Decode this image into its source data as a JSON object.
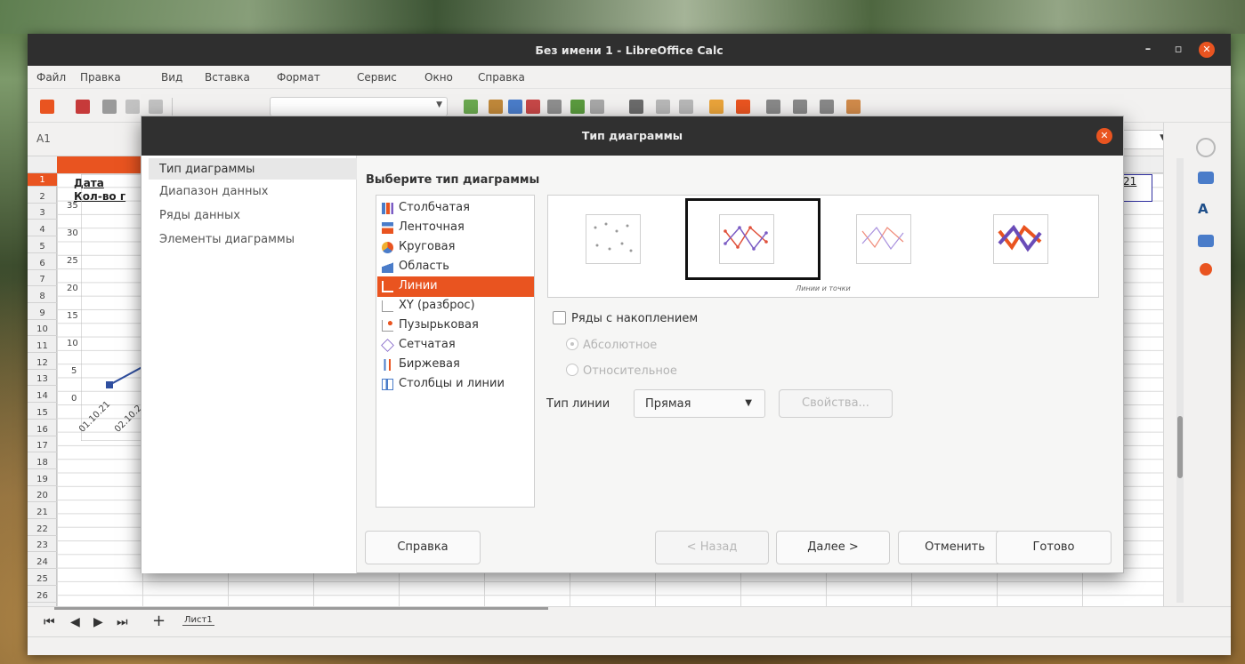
{
  "window": {
    "title": "Без имени 1 - LibreOffice Calc",
    "minimize": "–",
    "maximize": "▫",
    "close": "✕"
  },
  "menubar": [
    "Файл",
    "Правка",
    "Вид",
    "Вставка",
    "Формат",
    "Сервис",
    "Окно",
    "Справка"
  ],
  "formula": {
    "name_box": "A1"
  },
  "spreadsheet": {
    "rows": [
      "1",
      "2",
      "3",
      "4",
      "5",
      "6",
      "7",
      "8",
      "9",
      "10",
      "11",
      "12",
      "13",
      "14",
      "15",
      "16",
      "17",
      "18",
      "19",
      "20",
      "21",
      "22",
      "23",
      "24",
      "25",
      "26"
    ],
    "cell_a1": "Дата",
    "cell_a2": "Кол-во г",
    "cell_right_fragment": "21",
    "chart_y_ticks": [
      "35",
      "30",
      "25",
      "20",
      "15",
      "10",
      "5",
      "0"
    ],
    "chart_x_ticks": [
      "01.10.21",
      "02.10.2"
    ]
  },
  "sheet_tabs": {
    "nav": [
      "⏮",
      "◀",
      "▶",
      "⏭",
      "+"
    ],
    "active_tab": "Лист1"
  },
  "dialog": {
    "title": "Тип диаграммы",
    "close": "✕",
    "steps": [
      "Тип диаграммы",
      "Диапазон данных",
      "Ряды данных",
      "Элементы диаграммы"
    ],
    "heading": "Выберите тип диаграммы",
    "chart_types": [
      {
        "label": "Столбчатая",
        "icon": "column-chart-icon"
      },
      {
        "label": "Ленточная",
        "icon": "bar-chart-icon"
      },
      {
        "label": "Круговая",
        "icon": "pie-chart-icon"
      },
      {
        "label": "Область",
        "icon": "area-chart-icon"
      },
      {
        "label": "Линии",
        "icon": "line-chart-icon"
      },
      {
        "label": "XY (разброс)",
        "icon": "scatter-chart-icon"
      },
      {
        "label": "Пузырьковая",
        "icon": "bubble-chart-icon"
      },
      {
        "label": "Сетчатая",
        "icon": "net-chart-icon"
      },
      {
        "label": "Биржевая",
        "icon": "stock-chart-icon"
      },
      {
        "label": "Столбцы и линии",
        "icon": "column-line-chart-icon"
      }
    ],
    "selected_type": "Линии",
    "variant_caption": "Линии и точки",
    "stacked_label": "Ряды с накоплением",
    "absolute_label": "Абсолютное",
    "relative_label": "Относительное",
    "line_type_label": "Тип линии",
    "line_type_value": "Прямая",
    "properties_button": "Свойства...",
    "buttons": {
      "help": "Справка",
      "back": "< Назад",
      "next": "Далее >",
      "cancel": "Отменить",
      "finish": "Готово"
    }
  },
  "colors": {
    "accent": "#e95420",
    "titlebar": "#303030",
    "series1": "#e0503a",
    "series2": "#7b5cc4"
  }
}
